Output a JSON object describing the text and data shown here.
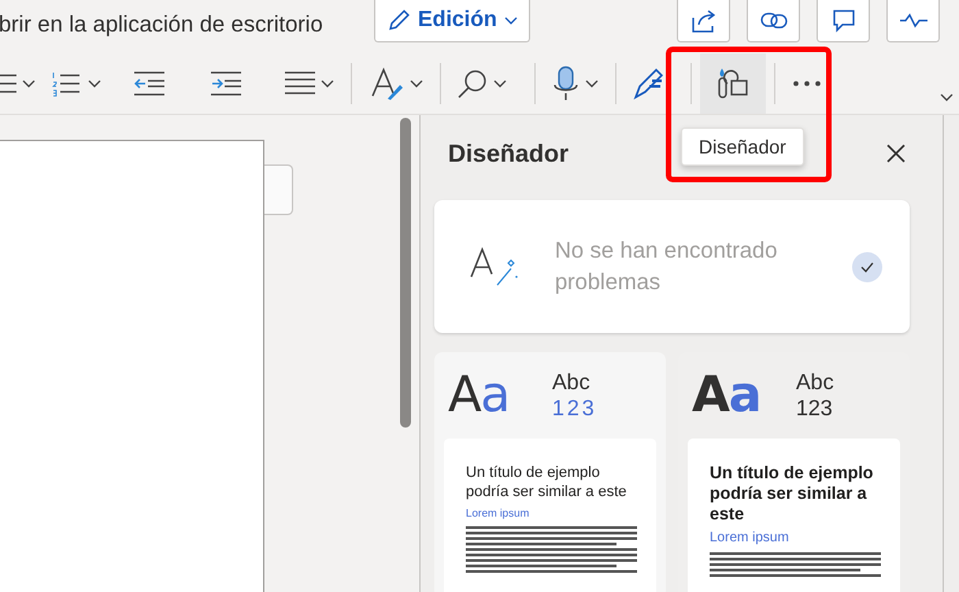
{
  "header": {
    "open_in_desktop": "brir en la aplicación de escritorio",
    "mode_button": "Edición"
  },
  "ribbon": {
    "designer_button": {
      "selected": true
    },
    "tooltip": "Diseñador"
  },
  "annotation": {
    "highlight": true
  },
  "panel": {
    "title": "Diseñador",
    "status": {
      "text": "No se han encontrado problemas",
      "checked": true
    },
    "themes": [
      {
        "kind": "light",
        "sample": "Aa",
        "abc": "Abc",
        "numbers": "123",
        "heading": "Un título de ejemplo podría ser similar a este",
        "subheading": "Lorem ipsum"
      },
      {
        "kind": "bold",
        "sample": "Aa",
        "abc": "Abc",
        "numbers": "123",
        "heading": "Un título de ejemplo podría ser similar a este",
        "subheading": "Lorem ipsum"
      }
    ]
  }
}
